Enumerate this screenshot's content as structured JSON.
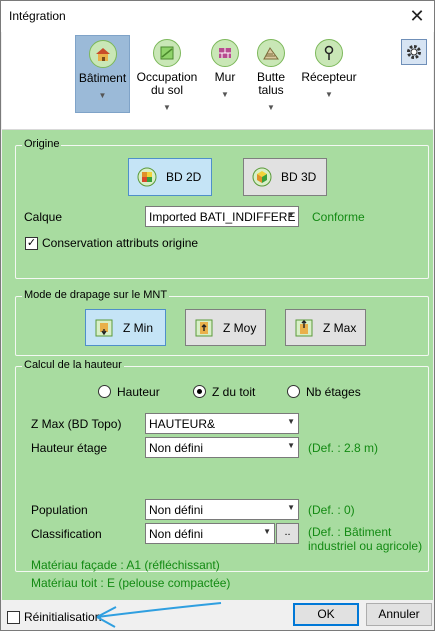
{
  "window": {
    "title": "Intégration",
    "close_glyph": "✕"
  },
  "ribbon": {
    "items": [
      {
        "label": "Bâtiment",
        "icon": "building-icon",
        "active": true
      },
      {
        "label": "Occupation du sol",
        "icon": "land-use-icon"
      },
      {
        "label": "Mur",
        "icon": "wall-icon"
      },
      {
        "label": "Butte talus",
        "icon": "embankment-icon"
      },
      {
        "label": "Récepteur",
        "icon": "receiver-icon"
      }
    ],
    "settings_icon": "gear-icon"
  },
  "origine": {
    "legend": "Origine",
    "bd2d": "BD 2D",
    "bd3d": "BD 3D",
    "calque_label": "Calque",
    "calque_value": "Imported BATI_INDIFFERE",
    "calque_status": "Conforme",
    "conservation_label": "Conservation attributs origine",
    "conservation_checked": true
  },
  "drapage": {
    "legend": "Mode de drapage sur le MNT",
    "zmin": "Z Min",
    "zmoy": "Z Moy",
    "zmax": "Z Max"
  },
  "hauteur": {
    "legend": "Calcul de la hauteur",
    "radio_hauteur": "Hauteur",
    "radio_ztoit": "Z du toit",
    "radio_nbetages": "Nb étages",
    "selected": "Z du toit",
    "zmax_label": "Z Max (BD Topo)",
    "zmax_value": "HAUTEUR&",
    "hauteur_etage_label": "Hauteur étage",
    "hauteur_etage_value": "Non défini",
    "hauteur_etage_def": "(Def. : 2.8 m)",
    "population_label": "Population",
    "population_value": "Non défini",
    "population_def": "(Def. : 0)",
    "classification_label": "Classification",
    "classification_value": "Non défini",
    "classification_button": "..",
    "classification_def_1": "(Def. : Bâtiment",
    "classification_def_2": "industriel ou agricole)",
    "materiau_facade": "Matériau façade : A1 (réfléchissant)",
    "materiau_toit": "Matériau toit : E (pelouse compactée)"
  },
  "footer": {
    "reinit_label": "Réinitialisation",
    "reinit_checked": false,
    "ok_label": "OK",
    "cancel_label": "Annuler"
  },
  "colors": {
    "panel": "#a8dca0",
    "accent": "#0078d7",
    "status_green": "#138a13",
    "annotation_arrow": "#2f9fe0"
  }
}
